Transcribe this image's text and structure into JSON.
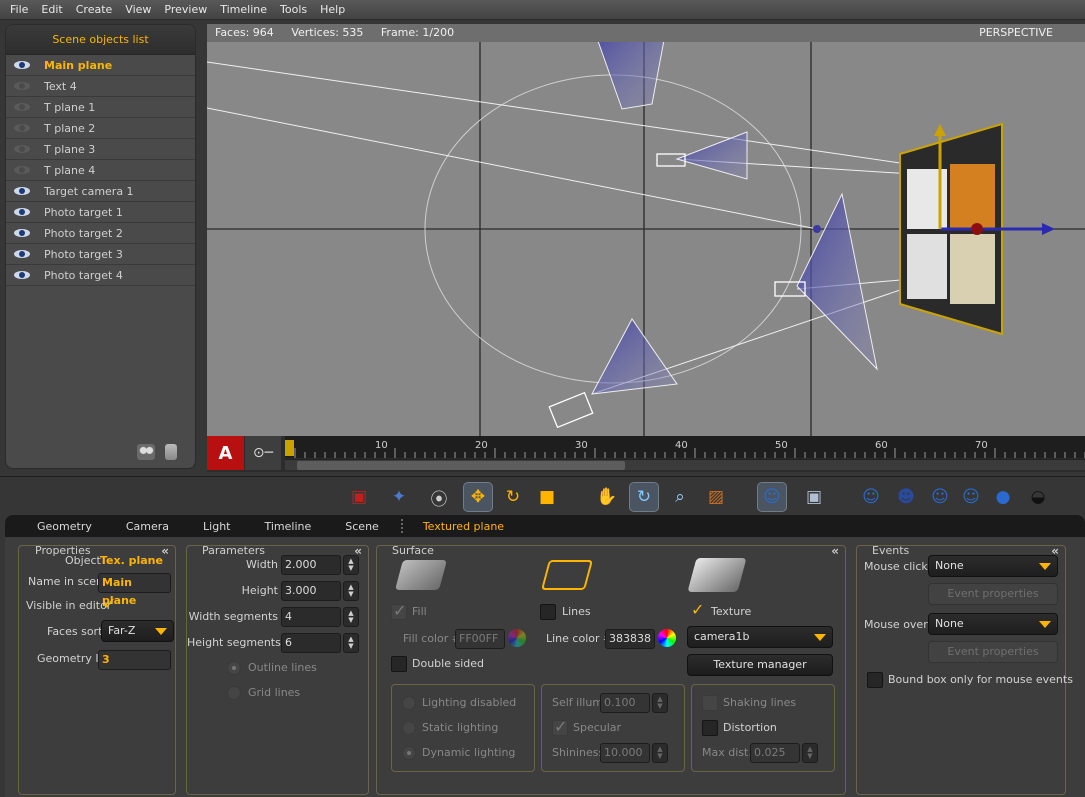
{
  "menu": [
    "File",
    "Edit",
    "Create",
    "View",
    "Preview",
    "Timeline",
    "Tools",
    "Help"
  ],
  "scene_panel": {
    "title": "Scene objects list",
    "items": [
      {
        "label": "Main plane",
        "visible": true,
        "active": true
      },
      {
        "label": "Text 4",
        "visible": false,
        "active": false
      },
      {
        "label": "T plane 1",
        "visible": false,
        "active": false
      },
      {
        "label": "T plane 2",
        "visible": false,
        "active": false
      },
      {
        "label": "T plane 3",
        "visible": false,
        "active": false
      },
      {
        "label": "T plane 4",
        "visible": false,
        "active": false
      },
      {
        "label": "Target camera 1",
        "visible": true,
        "active": false
      },
      {
        "label": "Photo target 1",
        "visible": true,
        "active": false
      },
      {
        "label": "Photo target 2",
        "visible": true,
        "active": false
      },
      {
        "label": "Photo target 3",
        "visible": true,
        "active": false
      },
      {
        "label": "Photo target 4",
        "visible": true,
        "active": false
      }
    ]
  },
  "viewport": {
    "faces": "Faces: 964",
    "vertices": "Vertices: 535",
    "frame": "Frame: 1/200",
    "view_mode": "PERSPECTIVE"
  },
  "timeline": {
    "record_label": "A",
    "ticks": [
      "10",
      "20",
      "30",
      "40",
      "50",
      "60",
      "70"
    ]
  },
  "tabs": [
    "Geometry",
    "Camera",
    "Light",
    "Timeline",
    "Scene",
    "Textured plane"
  ],
  "properties": {
    "title": "Properties",
    "object_label": "Object",
    "object_value": "Tex. plane",
    "name_label": "Name in scene",
    "name_value": "Main plane",
    "visible_label": "Visible in editor",
    "faces_sort_label": "Faces sort",
    "faces_sort_value": "Far-Z",
    "geometry_id_label": "Geometry ID",
    "geometry_id_value": "3"
  },
  "parameters": {
    "title": "Parameters",
    "width_label": "Width",
    "width_value": "2.000",
    "height_label": "Height",
    "height_value": "3.000",
    "wseg_label": "Width segments",
    "wseg_value": "4",
    "hseg_label": "Height segments",
    "hseg_value": "6",
    "outline_label": "Outline lines",
    "grid_label": "Grid lines"
  },
  "surface": {
    "title": "Surface",
    "fill_label": "Fill",
    "fill_color_label": "Fill color #",
    "fill_color_value": "FF00FF",
    "lines_label": "Lines",
    "line_color_label": "Line color #",
    "line_color_value": "383838",
    "texture_label": "Texture",
    "texture_value": "camera1b",
    "texture_manager_label": "Texture manager",
    "double_sided_label": "Double sided",
    "lighting_disabled_label": "Lighting disabled",
    "static_lighting_label": "Static lighting",
    "dynamic_lighting_label": "Dynamic lighting",
    "self_illum_label": "Self illum.",
    "self_illum_value": "0.100",
    "specular_label": "Specular",
    "shininess_label": "Shininess",
    "shininess_value": "10.000",
    "shaking_label": "Shaking lines",
    "distortion_label": "Distortion",
    "max_dist_label": "Max dist.",
    "max_dist_value": "0.025"
  },
  "events": {
    "title": "Events",
    "mouse_click_label": "Mouse click",
    "mouse_click_value": "None",
    "event_props_label": "Event properties",
    "mouse_over_label": "Mouse over",
    "mouse_over_value": "None",
    "bound_box_label": "Bound box only for mouse events"
  },
  "colors": {
    "accent": "#ffb400",
    "record": "#b81010"
  }
}
